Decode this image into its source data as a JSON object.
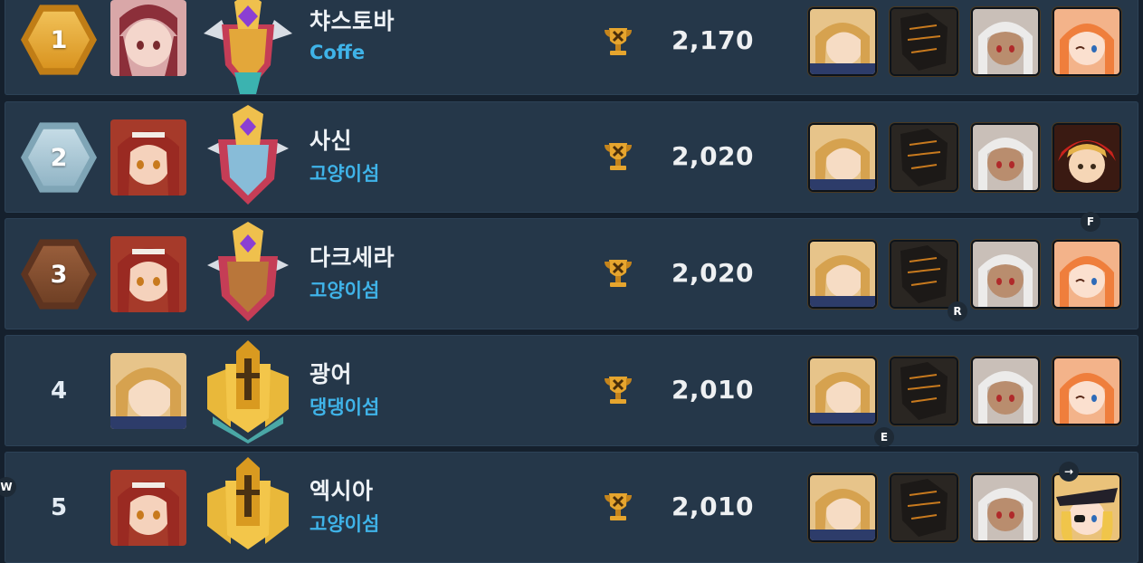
{
  "rankings": [
    {
      "rank": "1",
      "name": "챠스토바",
      "guild": "Coffe",
      "score": "2,170",
      "rank_style": "gold",
      "avatar": "red-hair-maid",
      "emblem": "legend-purple",
      "heroes": [
        "blonde-girl",
        "dark-armor",
        "white-hair",
        "orange-hair-wink"
      ]
    },
    {
      "rank": "2",
      "name": "사신",
      "guild": "고양이섬",
      "score": "2,020",
      "rank_style": "silver",
      "avatar": "red-curls-girl",
      "emblem": "master-purple",
      "heroes": [
        "blonde-girl",
        "dark-armor",
        "white-hair",
        "red-hood-boy"
      ]
    },
    {
      "rank": "3",
      "name": "다크세라",
      "guild": "고양이섬",
      "score": "2,020",
      "rank_style": "bronze",
      "avatar": "red-curls-girl",
      "emblem": "master-purple",
      "heroes": [
        "blonde-girl",
        "dark-armor",
        "white-hair",
        "orange-hair-wink"
      ]
    },
    {
      "rank": "4",
      "name": "광어",
      "guild": "댕댕이섬",
      "score": "2,010",
      "rank_style": "plain",
      "avatar": "blonde-girl",
      "emblem": "gold-helmet",
      "heroes": [
        "blonde-girl",
        "dark-armor",
        "white-hair",
        "orange-hair-wink"
      ]
    },
    {
      "rank": "5",
      "name": "엑시아",
      "guild": "고양이섬",
      "score": "2,010",
      "rank_style": "plain",
      "avatar": "red-curls-girl",
      "emblem": "gold-helmet",
      "heroes": [
        "blonde-girl",
        "dark-armor",
        "white-hair",
        "pirate-girl"
      ]
    }
  ],
  "markers": {
    "f": "F",
    "r": "R",
    "e": "E",
    "w": "W",
    "arrow": "→"
  },
  "colors": {
    "row_bg": "#253749",
    "guild": "#3fb3e8",
    "gold": "#e0a431",
    "silver": "#9ec3d4",
    "bronze": "#7a4a2e"
  }
}
